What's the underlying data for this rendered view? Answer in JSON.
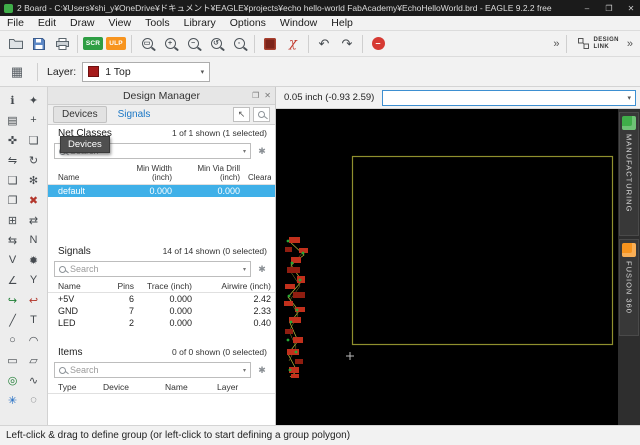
{
  "window": {
    "title": "2 Board - C:¥Users¥shi_y¥OneDrive¥ドキュメント¥EAGLE¥projects¥echo hello-world FabAcademy¥EchoHelloWorld.brd - EAGLE 9.2.2 free"
  },
  "icons": {
    "minimize": "–",
    "maximize": "❐",
    "close": "✕",
    "zoom_fit": "▭",
    "zoom_in": "+",
    "zoom_out": "−",
    "zoom_redraw": "↺",
    "zoom_select": "▫",
    "chi": "χ",
    "undo": "↶",
    "redo": "↷",
    "stop": "–",
    "overflow": "»",
    "grid": "▦",
    "caret_down": "▾",
    "panel_float": "❐",
    "panel_close": "✕",
    "cursor": "↖",
    "filter": "✱"
  },
  "colors": {
    "selection": "#3fb0e8",
    "command_border": "#3d8fd1",
    "scr_green": "#2e9e44",
    "ulp_orange": "#f7941e",
    "stop_red": "#d63a33",
    "app_green": "#3fae49"
  },
  "menu": {
    "items": [
      {
        "name": "menu-item-file",
        "label": "File"
      },
      {
        "name": "menu-item-edit",
        "label": "Edit"
      },
      {
        "name": "menu-item-draw",
        "label": "Draw"
      },
      {
        "name": "menu-item-view",
        "label": "View"
      },
      {
        "name": "menu-item-tools",
        "label": "Tools"
      },
      {
        "name": "menu-item-library",
        "label": "Library"
      },
      {
        "name": "menu-item-options",
        "label": "Options"
      },
      {
        "name": "menu-item-window",
        "label": "Window"
      },
      {
        "name": "menu-item-help",
        "label": "Help"
      }
    ]
  },
  "toolbar": {
    "scr_label": "SCR",
    "ulp_label": "ULP",
    "design_link": {
      "line1": "DESIGN",
      "line2": "LINK"
    }
  },
  "layerbar": {
    "label": "Layer:",
    "selected": "1 Top",
    "swatch_color": "#a61b1b"
  },
  "coordbar": {
    "position": "0.05 inch (-0.93 2.59)",
    "command_value": ""
  },
  "design_manager": {
    "title": "Design Manager",
    "tabs": [
      {
        "label": "Devices"
      },
      {
        "label": "Signals"
      }
    ],
    "tooltip": "Devices",
    "net_classes": {
      "label": "Net Classes",
      "count": "1 of 1 shown (1 selected)",
      "search_placeholder": "Search",
      "headers": {
        "name": "Name",
        "min_width": "Min Width\n(inch)",
        "min_via": "Min Via Drill\n(inch)",
        "clearance": "Clearance"
      },
      "rows": [
        {
          "name": "default",
          "min_width": "0.000",
          "min_via_drill": "0.000"
        }
      ]
    },
    "signals": {
      "label": "Signals",
      "count": "14 of 14 shown (0 selected)",
      "search_placeholder": "Search",
      "headers": {
        "name": "Name",
        "pins": "Pins",
        "trace": "Trace (inch)",
        "airwire": "Airwire (inch)"
      },
      "rows": [
        {
          "name": "+5V",
          "pins": "6",
          "trace": "0.000",
          "airwire": "2.42"
        },
        {
          "name": "GND",
          "pins": "7",
          "trace": "0.000",
          "airwire": "2.33"
        },
        {
          "name": "LED",
          "pins": "2",
          "trace": "0.000",
          "airwire": "0.40"
        }
      ]
    },
    "items": {
      "label": "Items",
      "count": "0 of 0 shown (0 selected)",
      "search_placeholder": "Search",
      "headers": {
        "type": "Type",
        "device": "Device",
        "name": "Name",
        "layer": "Layer"
      }
    }
  },
  "side_tabs": [
    {
      "label": "MANUFACTURING",
      "color": "#3fae49"
    },
    {
      "label": "FUSION 360",
      "color": "#f7941e"
    }
  ],
  "statusbar": {
    "message": "Left-click & drag to define group (or left-click to start defining a group polygon)"
  },
  "palette": {
    "tools": [
      {
        "name": "tool-info-icon",
        "glyph": "ℹ",
        "color": "#454a4f"
      },
      {
        "name": "tool-show-icon",
        "glyph": "✦",
        "color": "#454a4f"
      },
      {
        "name": "tool-display-icon",
        "glyph": "▤",
        "color": "#454a4f"
      },
      {
        "name": "tool-mark-icon",
        "glyph": "+",
        "color": "#454a4f"
      },
      {
        "name": "tool-move-icon",
        "glyph": "✜",
        "color": "#454a4f"
      },
      {
        "name": "tool-copy-icon",
        "glyph": "❏",
        "color": "#454a4f"
      },
      {
        "name": "tool-mirror-icon",
        "glyph": "⇋",
        "color": "#454a4f"
      },
      {
        "name": "tool-rotate-icon",
        "glyph": "↻",
        "color": "#454a4f"
      },
      {
        "name": "tool-group-icon",
        "glyph": "❑",
        "color": "#454a4f"
      },
      {
        "name": "tool-change-icon",
        "glyph": "✻",
        "color": "#454a4f"
      },
      {
        "name": "tool-paste-icon",
        "glyph": "❐",
        "color": "#454a4f"
      },
      {
        "name": "tool-delete-icon",
        "glyph": "✖",
        "color": "#b3372c"
      },
      {
        "name": "tool-add-icon",
        "glyph": "⊞",
        "color": "#454a4f"
      },
      {
        "name": "tool-pinswap-icon",
        "glyph": "⇄",
        "color": "#454a4f"
      },
      {
        "name": "tool-replace-icon",
        "glyph": "⇆",
        "color": "#454a4f"
      },
      {
        "name": "tool-name-icon",
        "glyph": "N",
        "color": "#454a4f"
      },
      {
        "name": "tool-value-icon",
        "glyph": "V",
        "color": "#454a4f"
      },
      {
        "name": "tool-smash-icon",
        "glyph": "✹",
        "color": "#454a4f"
      },
      {
        "name": "tool-miter-icon",
        "glyph": "∠",
        "color": "#454a4f"
      },
      {
        "name": "tool-split-icon",
        "glyph": "Y",
        "color": "#454a4f"
      },
      {
        "name": "tool-route-icon",
        "glyph": "↪",
        "color": "#1e7e34"
      },
      {
        "name": "tool-ripup-icon",
        "glyph": "↩",
        "color": "#b3372c"
      },
      {
        "name": "tool-wire-icon",
        "glyph": "╱",
        "color": "#454a4f"
      },
      {
        "name": "tool-text-icon",
        "glyph": "T",
        "color": "#454a4f"
      },
      {
        "name": "tool-circle-icon",
        "glyph": "○",
        "color": "#454a4f"
      },
      {
        "name": "tool-arc-icon",
        "glyph": "◠",
        "color": "#454a4f"
      },
      {
        "name": "tool-rect-icon",
        "glyph": "▭",
        "color": "#454a4f"
      },
      {
        "name": "tool-polygon-icon",
        "glyph": "▱",
        "color": "#454a4f"
      },
      {
        "name": "tool-via-icon",
        "glyph": "◎",
        "color": "#1e7e34"
      },
      {
        "name": "tool-signal-icon",
        "glyph": "∿",
        "color": "#454a4f"
      },
      {
        "name": "tool-ratsnest-icon",
        "glyph": "✳",
        "color": "#1565c0"
      },
      {
        "name": "tool-hole-icon",
        "glyph": "◌",
        "color": "#454a4f"
      }
    ]
  }
}
